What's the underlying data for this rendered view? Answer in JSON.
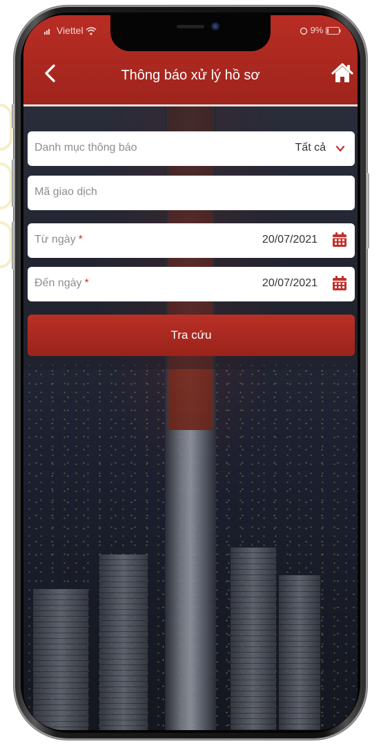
{
  "status_bar": {
    "carrier": "Viettel",
    "battery": "9%"
  },
  "header": {
    "title": "Thông báo xử lý hồ sơ",
    "back_icon": "chevron-left-icon",
    "home_icon": "home-icon"
  },
  "form": {
    "category": {
      "label": "Danh mục thông báo",
      "value": "Tất cả"
    },
    "transaction": {
      "placeholder": "Mã giao dịch",
      "value": ""
    },
    "from_date": {
      "label": "Từ ngày",
      "required_mark": "*",
      "value": "20/07/2021"
    },
    "to_date": {
      "label": "Đến ngày",
      "required_mark": "*",
      "value": "20/07/2021"
    },
    "search_button": "Tra cứu"
  },
  "colors": {
    "brand_red": "#b22a22",
    "required": "#c7322a"
  }
}
